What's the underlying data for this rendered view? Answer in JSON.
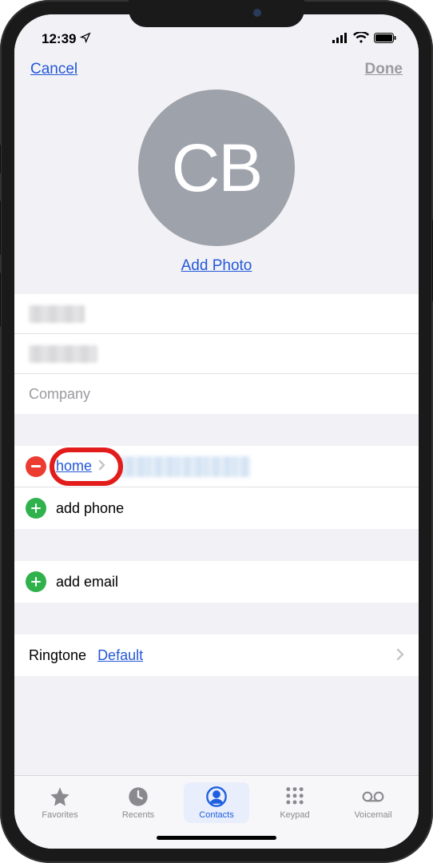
{
  "statusBar": {
    "time": "12:39"
  },
  "nav": {
    "cancel": "Cancel",
    "done": "Done"
  },
  "avatar": {
    "initials": "CB",
    "addPhoto": "Add Photo"
  },
  "nameFields": {
    "companyPlaceholder": "Company"
  },
  "phone": {
    "labelType": "home",
    "addPhone": "add phone"
  },
  "email": {
    "addEmail": "add email"
  },
  "ringtone": {
    "label": "Ringtone",
    "value": "Default"
  },
  "tabs": {
    "favorites": "Favorites",
    "recents": "Recents",
    "contacts": "Contacts",
    "keypad": "Keypad",
    "voicemail": "Voicemail"
  }
}
